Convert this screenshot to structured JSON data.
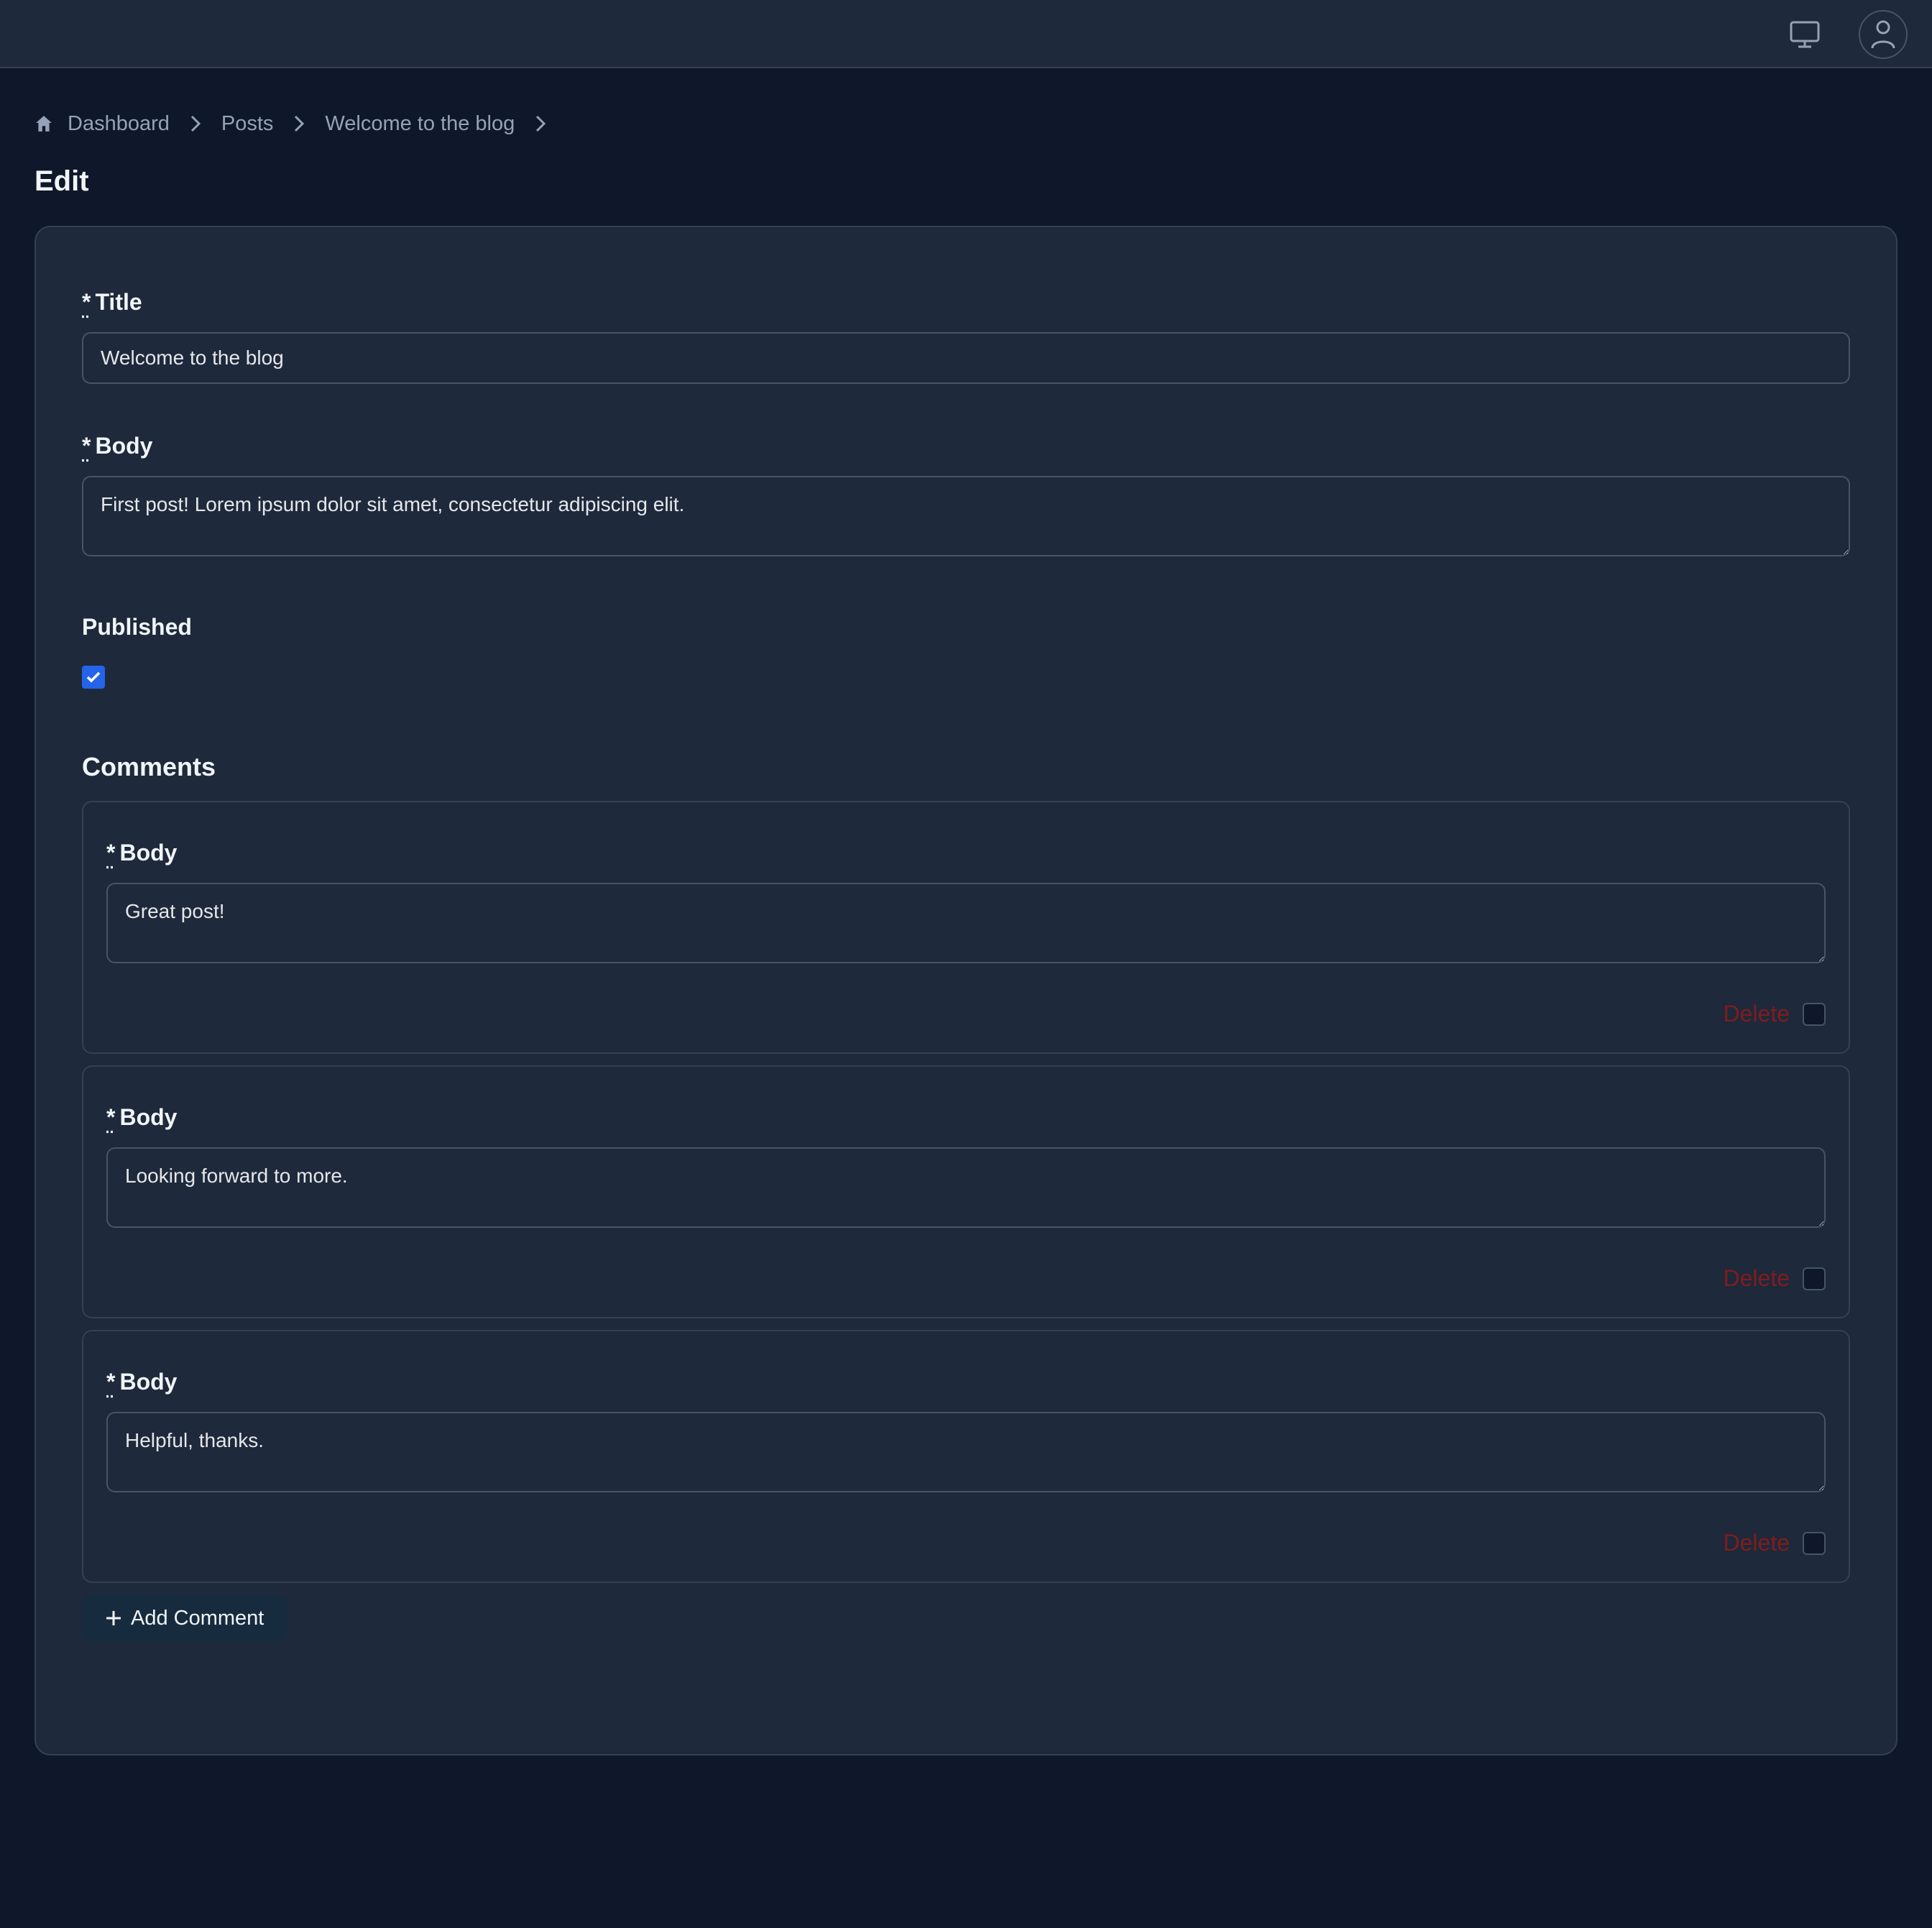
{
  "topbar": {
    "icons": [
      "monitor-icon",
      "user-icon"
    ]
  },
  "breadcrumb": {
    "home_icon": "home-icon",
    "items": [
      "Dashboard",
      "Posts",
      "Welcome to the blog"
    ]
  },
  "page": {
    "title": "Edit"
  },
  "form": {
    "title_field": {
      "required_mark": "*",
      "label": "Title",
      "value": "Welcome to the blog"
    },
    "body_field": {
      "required_mark": "*",
      "label": "Body",
      "value": "First post! Lorem ipsum dolor sit amet, consectetur adipiscing elit."
    },
    "published_field": {
      "label": "Published",
      "checked": true
    },
    "comments": {
      "title": "Comments",
      "items": [
        {
          "required_mark": "*",
          "label": "Body",
          "value": "Great post!",
          "delete_label": "Delete"
        },
        {
          "required_mark": "*",
          "label": "Body",
          "value": "Looking forward to more.",
          "delete_label": "Delete"
        },
        {
          "required_mark": "*",
          "label": "Body",
          "value": "Helpful, thanks.",
          "delete_label": "Delete"
        }
      ],
      "add_label": "Add Comment"
    }
  },
  "colors": {
    "background": "#0f172a",
    "surface": "#1e293b",
    "accent": "#2563eb",
    "danger": "#7f1d1d"
  }
}
